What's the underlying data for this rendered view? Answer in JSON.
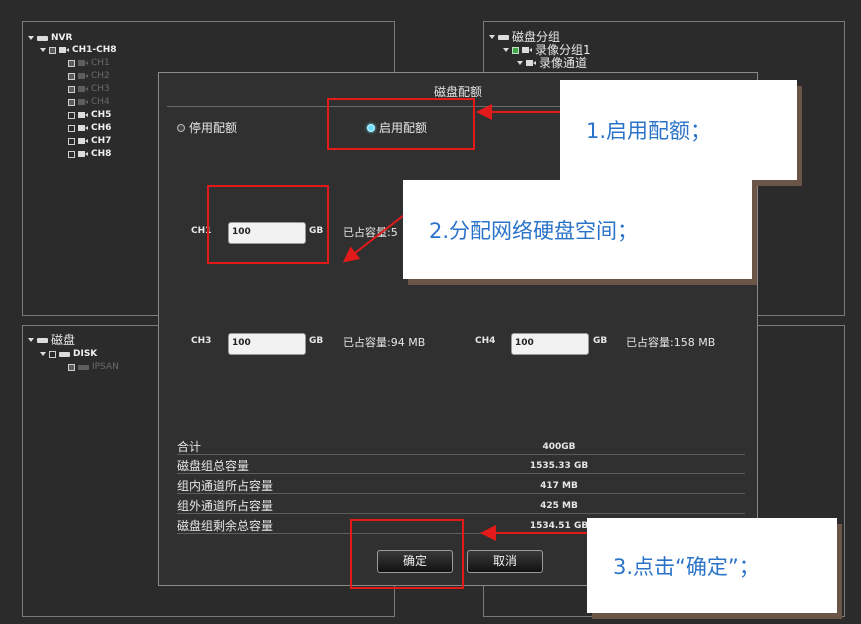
{
  "nvr_tree": {
    "root": "NVR",
    "group": "CH1-CH8",
    "dim_channels": [
      "CH1",
      "CH2",
      "CH3",
      "CH4"
    ],
    "channels": [
      "CH5",
      "CH6",
      "CH7",
      "CH8"
    ]
  },
  "disk_group_tree": {
    "root": "磁盘分组",
    "group": "录像分组1",
    "sub": "录像通道"
  },
  "disk_tree": {
    "root": "磁盘",
    "disk": "DISK",
    "ipsan_partial": "IPSAN"
  },
  "dialog": {
    "title": "磁盘配额",
    "radio_disable": "停用配额",
    "radio_enable": "启用配额",
    "unit": "GB",
    "rows": [
      {
        "ch": "CH1",
        "value": "100",
        "used": "已占容量:5"
      },
      {
        "ch": "CH3",
        "value": "100",
        "used": "已占容量:94 MB"
      },
      {
        "ch": "CH4",
        "value": "100",
        "used": "已占容量:158 MB"
      }
    ],
    "summary": [
      {
        "label": "合计",
        "value": "400GB"
      },
      {
        "label": "磁盘组总容量",
        "value": "1535.33 GB"
      },
      {
        "label": "组内通道所占容量",
        "value": "417 MB"
      },
      {
        "label": "组外通道所占容量",
        "value": "425 MB"
      },
      {
        "label": "磁盘组剩余总容量",
        "value": "1534.51 GB"
      }
    ],
    "ok_label": "确定",
    "cancel_label": "取消"
  },
  "callouts": {
    "step1": "1.启用配额；",
    "step2": "2.分配网络硬盘空间；",
    "step3": "3.点击“确定”；"
  },
  "colors": {
    "annotation_red": "#e31a1a",
    "callout_text": "#2a73c9",
    "selected_radio": "#6ee0ff"
  }
}
